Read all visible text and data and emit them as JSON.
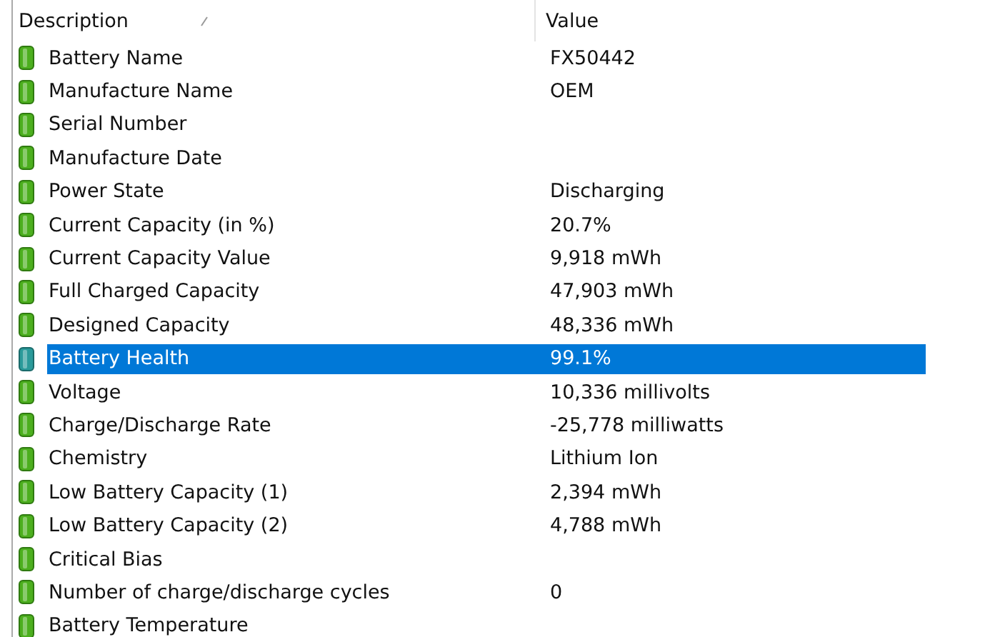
{
  "table": {
    "columns": [
      "Description",
      "Value"
    ],
    "rows": [
      {
        "description": "Battery Name",
        "value": "FX50442",
        "selected": false
      },
      {
        "description": "Manufacture Name",
        "value": "OEM",
        "selected": false
      },
      {
        "description": "Serial Number",
        "value": "",
        "selected": false
      },
      {
        "description": "Manufacture Date",
        "value": "",
        "selected": false
      },
      {
        "description": "Power State",
        "value": "Discharging",
        "selected": false
      },
      {
        "description": "Current Capacity (in %)",
        "value": "20.7%",
        "selected": false
      },
      {
        "description": "Current Capacity Value",
        "value": "9,918 mWh",
        "selected": false
      },
      {
        "description": "Full Charged Capacity",
        "value": "47,903 mWh",
        "selected": false
      },
      {
        "description": "Designed Capacity",
        "value": "48,336 mWh",
        "selected": false
      },
      {
        "description": "Battery Health",
        "value": "99.1%",
        "selected": true
      },
      {
        "description": "Voltage",
        "value": "10,336 millivolts",
        "selected": false
      },
      {
        "description": "Charge/Discharge Rate",
        "value": "-25,778 milliwatts",
        "selected": false
      },
      {
        "description": "Chemistry",
        "value": "Lithium Ion",
        "selected": false
      },
      {
        "description": "Low Battery Capacity (1)",
        "value": "2,394 mWh",
        "selected": false
      },
      {
        "description": "Low Battery Capacity (2)",
        "value": "4,788 mWh",
        "selected": false
      },
      {
        "description": "Critical Bias",
        "value": "",
        "selected": false
      },
      {
        "description": "Number of charge/discharge cycles",
        "value": "0",
        "selected": false
      },
      {
        "description": "Battery Temperature",
        "value": "",
        "selected": false
      }
    ]
  }
}
